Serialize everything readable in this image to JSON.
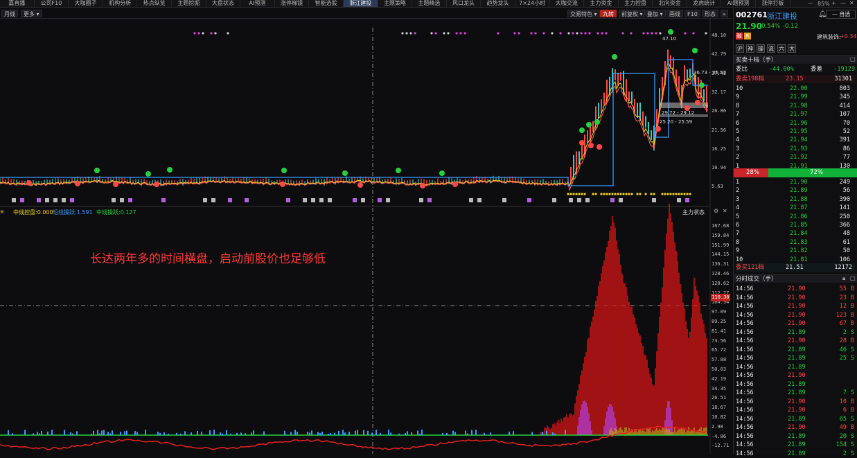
{
  "top_nav": [
    "嘉直播",
    "公司F10",
    "大咖圈子",
    "机构分析",
    "热点纵览",
    "主题挖掘",
    "大盘状态",
    "AI预测",
    "涨停梯镜",
    "智能选股",
    "浙江建投",
    "主题策略",
    "主题精选",
    "风口龙头",
    "趋势龙头",
    "7×24小时",
    "大咖交流",
    "主力资金",
    "主力控盘",
    "北向资金",
    "龙虎统计",
    "AI题预测",
    "涨停打板"
  ],
  "active_tab": "浙江建投",
  "zoom": "85%",
  "toolbar": {
    "period": "月线",
    "more": "更多",
    "buttons": [
      "交易特色",
      "九转",
      "前复权",
      "叠加",
      "画线",
      "F10",
      "形态"
    ]
  },
  "chart": {
    "price_ticks": [
      "48.10",
      "42.79",
      "37.48",
      "32.17",
      "26.86",
      "21.56",
      "16.25",
      "10.94",
      "5.63"
    ],
    "range_labels": [
      "47.10",
      "36.73 - 36.57",
      "29.72 - 29.12",
      "25.20 - 25.59"
    ],
    "indicator_title": "主力状态",
    "indicators": [
      {
        "label": "中线控盘:0.000",
        "color": "#f2d21b"
      },
      {
        "label": "短线操跃:1.591",
        "color": "#3a9cff"
      },
      {
        "label": "中线操跃:0.127",
        "color": "#25d140"
      }
    ],
    "indicator_ticks": [
      "167.68",
      "159.84",
      "151.99",
      "144.15",
      "136.31",
      "128.46",
      "120.62",
      "112.77",
      "104.94",
      "97.09",
      "89.25",
      "81.41",
      "73.56",
      "65.72",
      "57.88",
      "50.03",
      "42.19",
      "34.35",
      "26.51",
      "18.67",
      "10.82",
      "2.98",
      "-4.86",
      "-12.71"
    ],
    "crosshair_value": "110.30",
    "annotation": "长达两年多的时间横盘，启动前股价也足够低",
    "mascot_badge": "中"
  },
  "quote": {
    "code": "002761",
    "name": "浙江建投",
    "price": "21.90",
    "change_pct": "-0.54%",
    "change": "-0.12",
    "self_select": "自选",
    "sector_name": "建筑装饰:",
    "sector_change": "+0.34%",
    "tags": [
      "沪",
      "神",
      "操",
      "流",
      "六",
      "大"
    ],
    "book_title": "买卖十档（手）",
    "weibi_label": "委比",
    "weibi_value": "-44.00%",
    "weicha_label": "委差",
    "weicha_value": "-19129",
    "sell_total_label": "委卖198档",
    "sell_total_price": "23.15",
    "sell_total_vol": "31301",
    "asks": [
      {
        "lvl": "10",
        "price": "22.00",
        "vol": "803"
      },
      {
        "lvl": "9",
        "price": "21.99",
        "vol": "345"
      },
      {
        "lvl": "8",
        "price": "21.98",
        "vol": "414"
      },
      {
        "lvl": "7",
        "price": "21.97",
        "vol": "107"
      },
      {
        "lvl": "6",
        "price": "21.96",
        "vol": "70"
      },
      {
        "lvl": "5",
        "price": "21.95",
        "vol": "52"
      },
      {
        "lvl": "4",
        "price": "21.94",
        "vol": "391"
      },
      {
        "lvl": "3",
        "price": "21.93",
        "vol": "86"
      },
      {
        "lvl": "2",
        "price": "21.92",
        "vol": "77"
      },
      {
        "lvl": "1",
        "price": "21.91",
        "vol": "130"
      }
    ],
    "ratio_sell": "28%",
    "ratio_buy": "72%",
    "ratio_sell_fraction": 0.28,
    "bids": [
      {
        "lvl": "1",
        "price": "21.90",
        "vol": "249"
      },
      {
        "lvl": "2",
        "price": "21.89",
        "vol": "56"
      },
      {
        "lvl": "3",
        "price": "21.88",
        "vol": "390"
      },
      {
        "lvl": "4",
        "price": "21.87",
        "vol": "141"
      },
      {
        "lvl": "5",
        "price": "21.86",
        "vol": "250"
      },
      {
        "lvl": "6",
        "price": "21.85",
        "vol": "366"
      },
      {
        "lvl": "7",
        "price": "21.84",
        "vol": "48"
      },
      {
        "lvl": "8",
        "price": "21.83",
        "vol": "61"
      },
      {
        "lvl": "9",
        "price": "21.82",
        "vol": "50"
      },
      {
        "lvl": "10",
        "price": "21.81",
        "vol": "106"
      }
    ],
    "buy_total_label": "委买121档",
    "buy_total_price": "21.51",
    "buy_total_vol": "12172",
    "ticks_title": "分时成交（手）",
    "ticks": [
      {
        "t": "14:56",
        "p": "21.90",
        "v": "55",
        "s": "B"
      },
      {
        "t": "14:56",
        "p": "21.90",
        "v": "23",
        "s": "B"
      },
      {
        "t": "14:56",
        "p": "21.90",
        "v": "12",
        "s": "B"
      },
      {
        "t": "14:56",
        "p": "21.90",
        "v": "123",
        "s": "B"
      },
      {
        "t": "14:56",
        "p": "21.90",
        "v": "67",
        "s": "B"
      },
      {
        "t": "14:56",
        "p": "21.89",
        "v": "2",
        "s": "S"
      },
      {
        "t": "14:56",
        "p": "21.90",
        "v": "28",
        "s": "B"
      },
      {
        "t": "14:56",
        "p": "21.89",
        "v": "46",
        "s": "S"
      },
      {
        "t": "14:56",
        "p": "21.89",
        "v": "25",
        "s": "S"
      },
      {
        "t": "14:56",
        "p": "21.89",
        "v": "",
        "s": ""
      },
      {
        "t": "14:56",
        "p": "21.90",
        "v": "",
        "s": ""
      },
      {
        "t": "14:56",
        "p": "21.89",
        "v": "",
        "s": ""
      },
      {
        "t": "14:56",
        "p": "21.89",
        "v": "7",
        "s": "S"
      },
      {
        "t": "14:56",
        "p": "21.90",
        "v": "10",
        "s": "B"
      },
      {
        "t": "14:56",
        "p": "21.90",
        "v": "6",
        "s": "B"
      },
      {
        "t": "14:56",
        "p": "21.89",
        "v": "65",
        "s": "S"
      },
      {
        "t": "14:56",
        "p": "21.90",
        "v": "49",
        "s": "B"
      },
      {
        "t": "14:56",
        "p": "21.89",
        "v": "20",
        "s": "S"
      },
      {
        "t": "14:56",
        "p": "21.89",
        "v": "154",
        "s": "S"
      },
      {
        "t": "14:56",
        "p": "21.89",
        "v": "2",
        "s": "S"
      }
    ]
  },
  "colors": {
    "up": "#ff4848",
    "down": "#25d140",
    "accent": "#2d3b57",
    "price_line": "#3a9cff",
    "bid_bar": "#12b23a",
    "ask_bar": "#c8262a"
  }
}
